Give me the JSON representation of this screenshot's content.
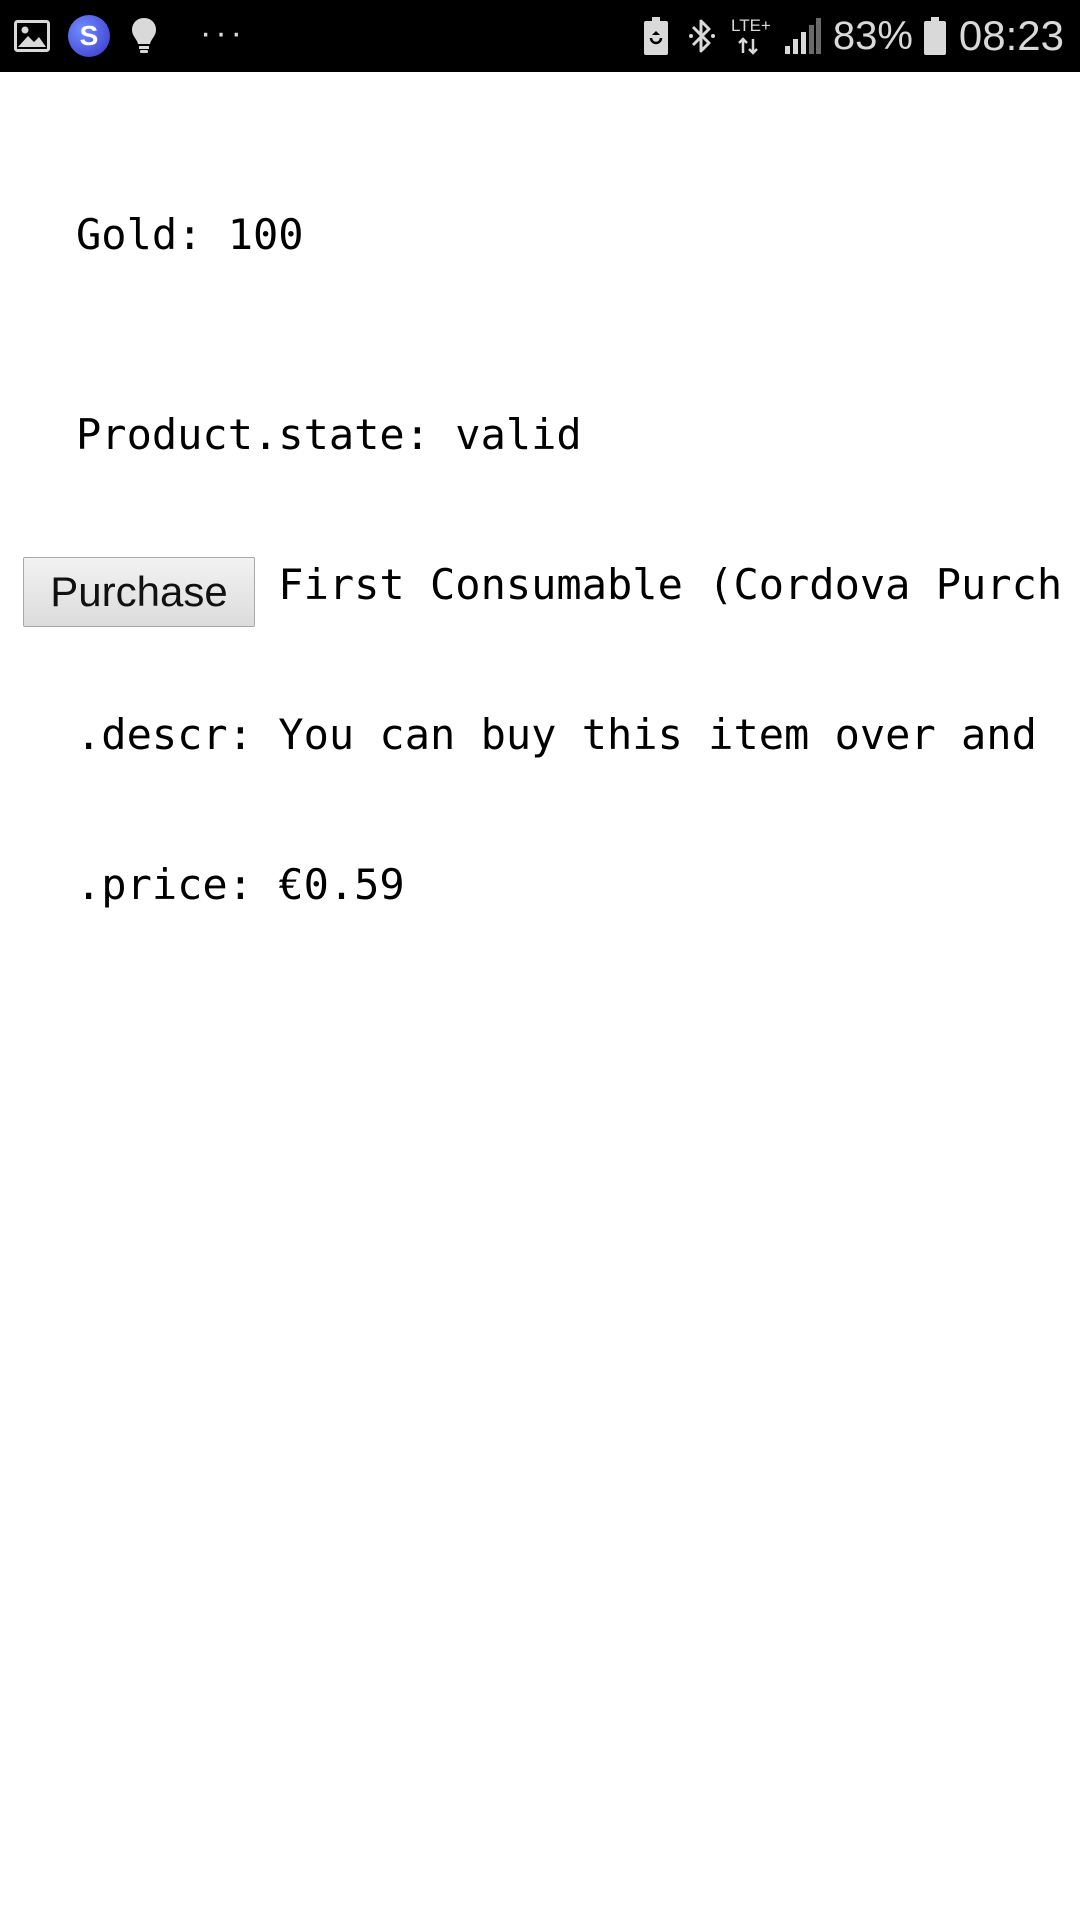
{
  "status_bar": {
    "left_icons": [
      "gallery-icon",
      "s-app-icon",
      "lightbulb-icon",
      "more-notifications-icon"
    ],
    "s_app_letter": "S",
    "more_glyph": "···",
    "right_icons": [
      "battery-saver-icon",
      "bluetooth-icon",
      "lte-plus-icon",
      "signal-icon",
      "battery-icon"
    ],
    "network_label": "LTE+",
    "battery_percent": "83%",
    "time": "08:23"
  },
  "game": {
    "gold_line": "Gold: 100"
  },
  "product": {
    "state_line": "Product.state: valid",
    "title_line": ".title: First Consumable (Cordova Purch",
    "descr_line": ".descr: You can buy this item over and",
    "price_line": ".price: €0.59"
  },
  "actions": {
    "purchase_label": "Purchase"
  },
  "colors": {
    "status_bar_bg": "#000000",
    "status_icons": "#d9d9d9",
    "s_app_badge": "#4a50e0"
  }
}
